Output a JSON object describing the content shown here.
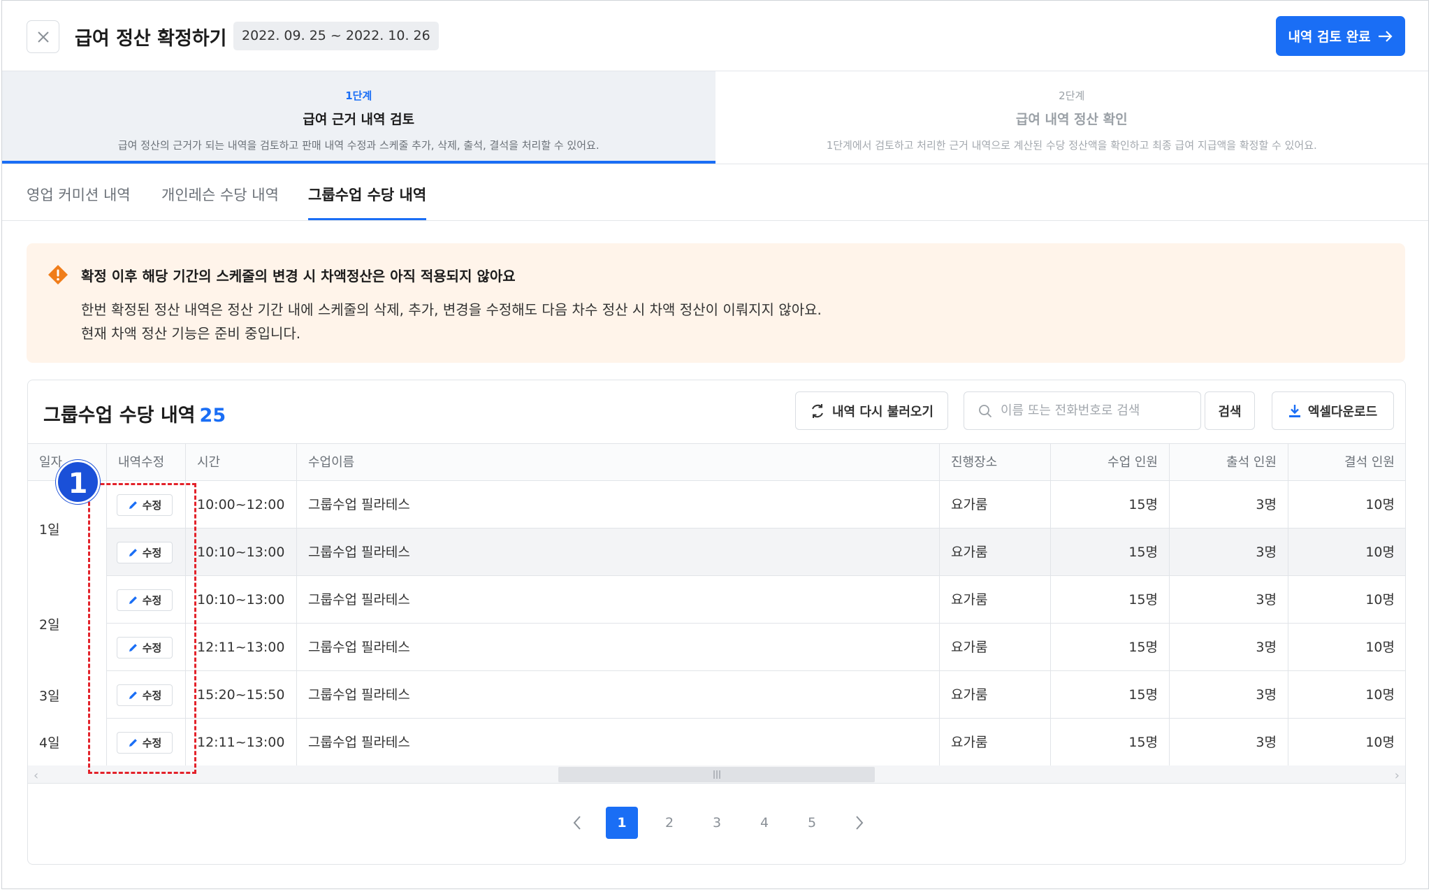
{
  "header": {
    "title": "급여 정산 확정하기",
    "period": "2022. 09. 25 ~ 2022. 10. 26",
    "done_label": "내역 검토 완료"
  },
  "steps": [
    {
      "no": "1단계",
      "title": "급여 근거 내역 검토",
      "desc": "급여 정산의 근거가 되는 내역을 검토하고 판매 내역 수정과 스케줄 추가, 삭제, 출석, 결석을 처리할 수 있어요."
    },
    {
      "no": "2단계",
      "title": "급여 내역 정산 확인",
      "desc": "1단계에서 검토하고 처리한 근거 내역으로 계산된 수당 정산액을 확인하고 최종 급여 지급액을 확정할 수 있어요."
    }
  ],
  "tabs": [
    "영업 커미션 내역",
    "개인레슨 수당 내역",
    "그룹수업 수당 내역"
  ],
  "notice": {
    "title": "확정 이후 해당 기간의 스케줄의 변경 시 차액정산은 아직 적용되지 않아요",
    "line1": "한번 확정된 정산 내역은 정산 기간 내에 스케줄의 삭제, 추가, 변경을 수정해도 다음 차수 정산 시 차액 정산이 이뤄지지 않아요.",
    "line2": "현재 차액 정산 기능은 준비 중입니다."
  },
  "card": {
    "title": "그룹수업 수당 내역",
    "count": "25",
    "reload_label": "내역 다시 불러오기",
    "search_placeholder": "이름 또는 전화번호로 검색",
    "search_label": "검색",
    "excel_label": "엑셀다운로드"
  },
  "table": {
    "headers": [
      "일자",
      "내역수정",
      "시간",
      "수업이름",
      "진행장소",
      "수업 인원",
      "출석 인원",
      "결석 인원"
    ],
    "edit_label": "수정",
    "days": [
      "1일",
      "2일",
      "3일",
      "4일"
    ],
    "rows": [
      {
        "time": "10:00~12:00",
        "name": "그룹수업 필라테스",
        "place": "요가룸",
        "cap": "15명",
        "att": "3명",
        "abs": "10명"
      },
      {
        "time": "10:10~13:00",
        "name": "그룹수업 필라테스",
        "place": "요가룸",
        "cap": "15명",
        "att": "3명",
        "abs": "10명"
      },
      {
        "time": "10:10~13:00",
        "name": "그룹수업 필라테스",
        "place": "요가룸",
        "cap": "15명",
        "att": "3명",
        "abs": "10명"
      },
      {
        "time": "12:11~13:00",
        "name": "그룹수업 필라테스",
        "place": "요가룸",
        "cap": "15명",
        "att": "3명",
        "abs": "10명"
      },
      {
        "time": "15:20~15:50",
        "name": "그룹수업 필라테스",
        "place": "요가룸",
        "cap": "15명",
        "att": "3명",
        "abs": "10명"
      },
      {
        "time": "12:11~13:00",
        "name": "그룹수업 필라테스",
        "place": "요가룸",
        "cap": "15명",
        "att": "3명",
        "abs": "10명"
      }
    ]
  },
  "pagination": {
    "pages": [
      "1",
      "2",
      "3",
      "4",
      "5"
    ],
    "current": "1"
  },
  "annotation": {
    "badge": "1"
  },
  "colors": {
    "accent": "#1a6ef5",
    "notice_bg": "#fff4ea",
    "warning": "#f07d1a",
    "annotation": "#e3222a"
  }
}
